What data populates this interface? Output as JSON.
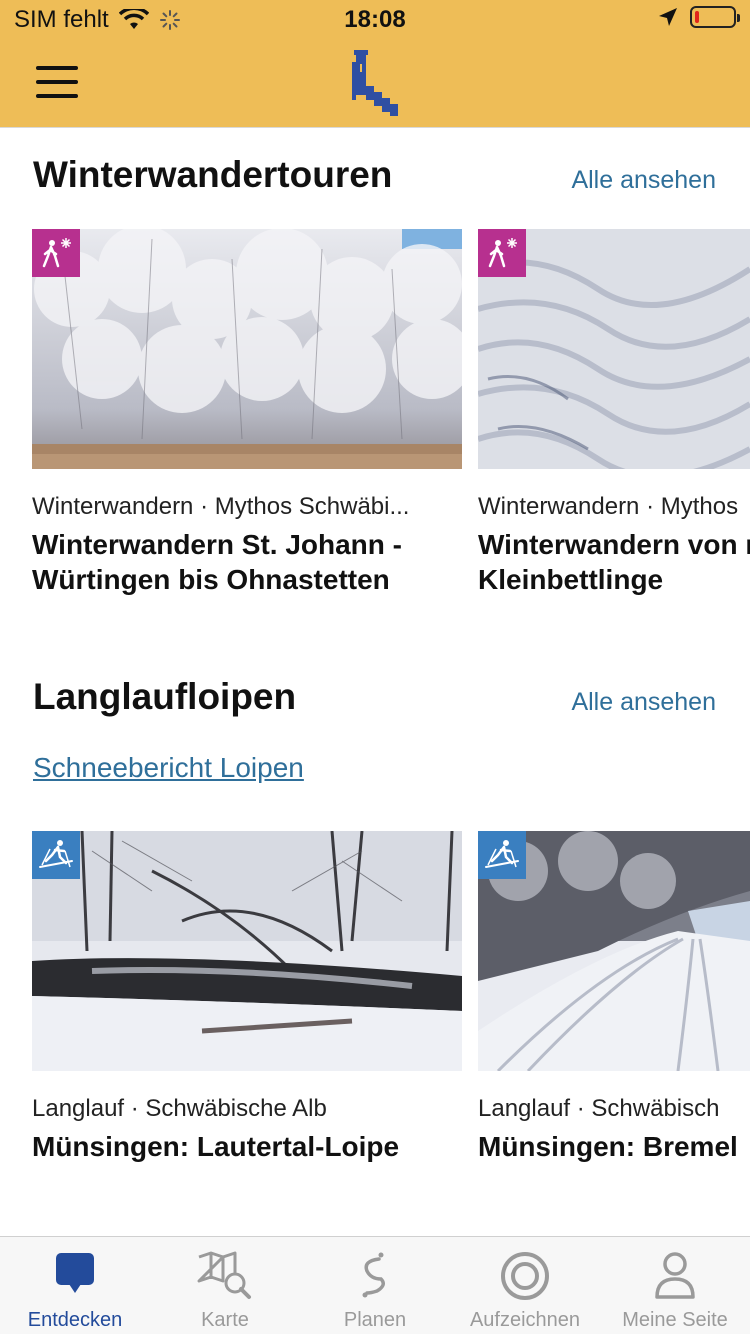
{
  "status": {
    "carrier": "SIM fehlt",
    "time": "18:08"
  },
  "app": {
    "colors": {
      "header": "#eebd57",
      "link": "#2f6f9a",
      "active_tab": "#234b9b"
    }
  },
  "sections": [
    {
      "title": "Winterwandertouren",
      "see_all": "Alle ansehen",
      "cards": [
        {
          "category": "Winterwandern · Mythos Schwäbi...",
          "title": "Winterwandern St. Johann - Würtingen bis Ohnastetten",
          "icon": "winter-hiking-icon"
        },
        {
          "category": "Winterwandern · Mythos",
          "title": "Winterwandern von nach Kleinbettlinge",
          "icon": "winter-hiking-icon"
        }
      ]
    },
    {
      "title": "Langlaufloipen",
      "see_all": "Alle ansehen",
      "link": "Schneebericht Loipen",
      "cards": [
        {
          "category": "Langlauf · Schwäbische Alb",
          "title": "Münsingen: Lautertal-Loipe",
          "icon": "cross-country-ski-icon"
        },
        {
          "category": "Langlauf · Schwäbisch",
          "title": "Münsingen: Bremel",
          "icon": "cross-country-ski-icon"
        }
      ]
    }
  ],
  "tabs": [
    {
      "label": "Entdecken",
      "icon": "discover-icon",
      "active": true
    },
    {
      "label": "Karte",
      "icon": "map-search-icon",
      "active": false
    },
    {
      "label": "Planen",
      "icon": "route-plan-icon",
      "active": false
    },
    {
      "label": "Aufzeichnen",
      "icon": "record-icon",
      "active": false
    },
    {
      "label": "Meine Seite",
      "icon": "profile-icon",
      "active": false
    }
  ]
}
